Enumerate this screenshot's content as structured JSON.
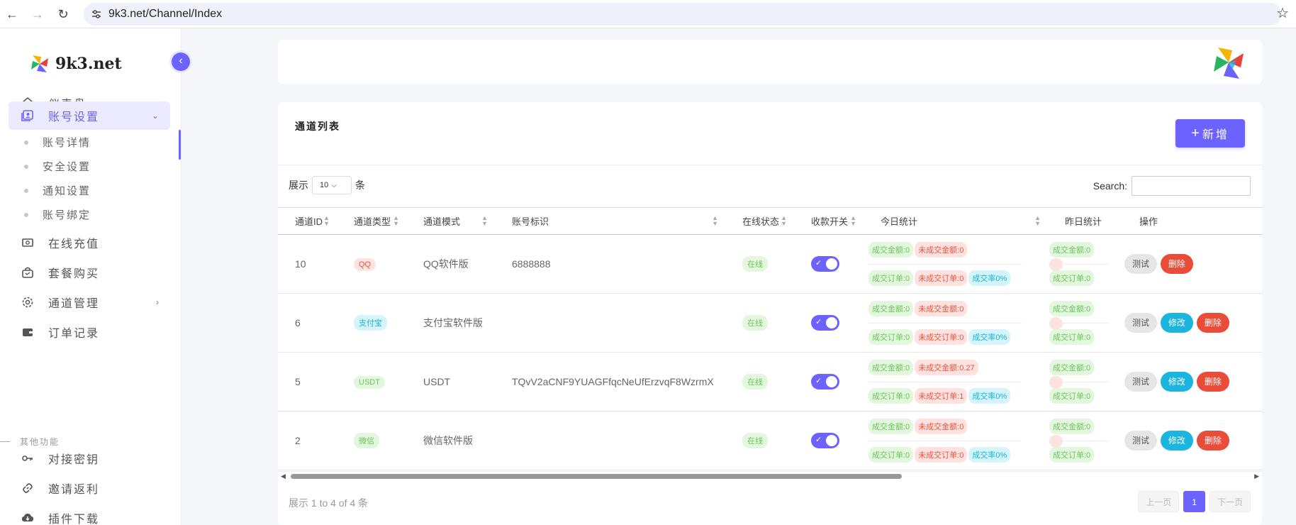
{
  "browser": {
    "url": "9k3.net/Channel/Index"
  },
  "brand": {
    "name": "9k3.net",
    "accent": "#6c63ff"
  },
  "sidebar": {
    "items": [
      {
        "label": "仪表盘",
        "icon": "home-icon"
      },
      {
        "label": "账号设置",
        "icon": "account-icon",
        "active": true
      },
      {
        "label": "在线充值",
        "icon": "money-icon"
      },
      {
        "label": "套餐购买",
        "icon": "bag-icon"
      },
      {
        "label": "通道管理",
        "icon": "gear-icon"
      },
      {
        "label": "订单记录",
        "icon": "wallet-icon"
      }
    ],
    "sub_items": [
      "账号详情",
      "安全设置",
      "通知设置",
      "账号绑定"
    ],
    "section": "其他功能",
    "other_items": [
      {
        "label": "对接密钥",
        "icon": "key-icon"
      },
      {
        "label": "邀请返利",
        "icon": "link-icon"
      },
      {
        "label": "插件下载",
        "icon": "download-icon"
      }
    ]
  },
  "card": {
    "title": "通道列表",
    "add_label": "新增",
    "show_prefix": "展示",
    "page_size": "10",
    "show_suffix": "条",
    "search_label": "Search:",
    "info": "展示 1 to 4 of 4 条",
    "pager": {
      "prev": "上一页",
      "current": "1",
      "next": "下一页"
    }
  },
  "table": {
    "headers": [
      "通道ID",
      "通道类型",
      "通道模式",
      "账号标识",
      "在线状态",
      "收款开关",
      "今日统计",
      "昨日统计",
      "操作"
    ],
    "rows": [
      {
        "id": "10",
        "type": "QQ",
        "type_color": "red",
        "mode": "QQ软件版",
        "account": "6888888",
        "status": "在线",
        "today": {
          "ok_amount": "成交金额:0",
          "fail_amount": "未成交金额:0",
          "ok_orders": "成交订单:0",
          "fail_orders": "未成交订单:0",
          "rate": "成交率0%"
        },
        "yest": {
          "ok_amount": "成交金额:0",
          "ok_orders": "成交订单:0"
        },
        "ops": [
          "测试",
          "删除"
        ]
      },
      {
        "id": "6",
        "type": "支付宝",
        "type_color": "cyan",
        "mode": "支付宝软件版",
        "account": "",
        "status": "在线",
        "today": {
          "ok_amount": "成交金额:0",
          "fail_amount": "未成交金额:0",
          "ok_orders": "成交订单:0",
          "fail_orders": "未成交订单:0",
          "rate": "成交率0%"
        },
        "yest": {
          "ok_amount": "成交金额:0",
          "ok_orders": "成交订单:0"
        },
        "ops": [
          "测试",
          "修改",
          "删除"
        ]
      },
      {
        "id": "5",
        "type": "USDT",
        "type_color": "green",
        "mode": "USDT",
        "account": "TQvV2aCNF9YUAGFfqcNeUfErzvqF8WzrmX",
        "status": "在线",
        "today": {
          "ok_amount": "成交金额:0",
          "fail_amount": "未成交金额:0.27",
          "ok_orders": "成交订单:0",
          "fail_orders": "未成交订单:1",
          "rate": "成交率0%"
        },
        "yest": {
          "ok_amount": "成交金额:0",
          "ok_orders": "成交订单:0"
        },
        "ops": [
          "测试",
          "修改",
          "删除"
        ]
      },
      {
        "id": "2",
        "type": "微信",
        "type_color": "green",
        "mode": "微信软件版",
        "account": "",
        "status": "在线",
        "today": {
          "ok_amount": "成交金额:0",
          "fail_amount": "未成交金额:0",
          "ok_orders": "成交订单:0",
          "fail_orders": "未成交订单:0",
          "rate": "成交率0%"
        },
        "yest": {
          "ok_amount": "成交金额:0",
          "ok_orders": "成交订单:0"
        },
        "ops": [
          "测试",
          "修改",
          "删除"
        ]
      }
    ]
  }
}
